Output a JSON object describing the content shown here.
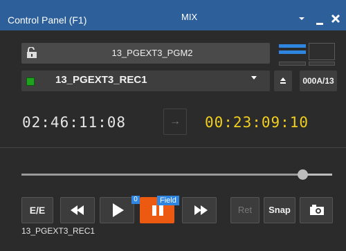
{
  "window": {
    "title": "Control Panel (F1)",
    "mix_label": "MIX",
    "icons": [
      "chevron-down-icon",
      "minimize-icon",
      "close-icon"
    ]
  },
  "source": {
    "lock_icon": "lock-icon",
    "pgm_name": "13_PGEXT3_PGM2",
    "rec_name": "13_PGEXT3_REC1",
    "clip_count": "000A/13"
  },
  "timecodes": {
    "left": "02:46:11:08",
    "arrow": "→",
    "right": "00:23:09:10"
  },
  "slider": {
    "position": 0.91
  },
  "transport": {
    "ee_label": "E/E",
    "play_badge": "0",
    "pause_badge": "Field",
    "ret_label": "Ret",
    "snap_label": "Snap"
  },
  "footer": {
    "clip_label": "13_PGEXT3_REC1"
  },
  "colors": {
    "titlebar": "#2d5f9a",
    "accent_blue": "#2f86e0",
    "pause_orange": "#ec5a12",
    "timecode_yellow": "#f2cf1e",
    "rec_green": "#1fa31f"
  }
}
